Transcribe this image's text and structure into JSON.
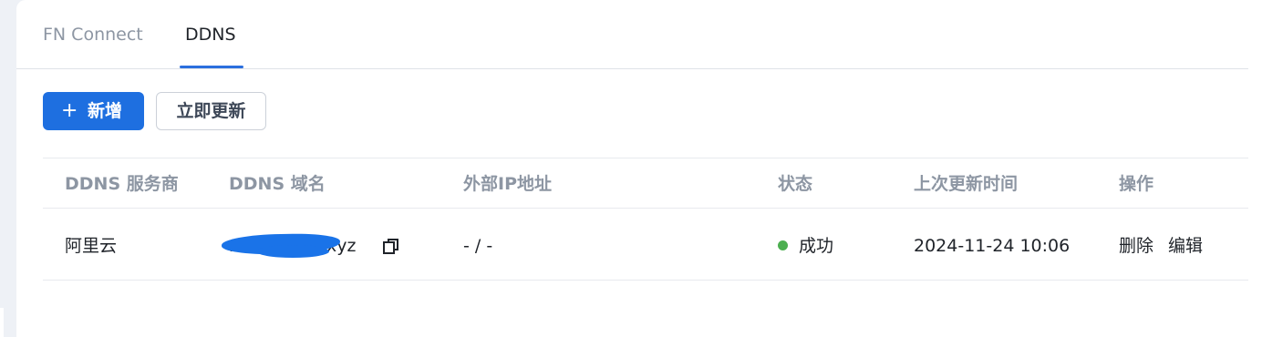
{
  "tabs": [
    {
      "label": "FN Connect",
      "active": false
    },
    {
      "label": "DDNS",
      "active": true
    }
  ],
  "toolbar": {
    "add_icon": "+",
    "add_label": "新增",
    "refresh_label": "立即更新"
  },
  "table": {
    "headers": [
      "DDNS 服务商",
      "DDNS 域名",
      "外部IP地址",
      "状态",
      "上次更新时间",
      "操作"
    ],
    "rows": [
      {
        "provider": "阿里云",
        "domain": "m.z·········0.xyz",
        "external_ip": "- / -",
        "status": "成功",
        "status_color": "#4caf50",
        "last_update": "2024-11-24 10:06",
        "actions": {
          "delete": "删除",
          "edit": "编辑"
        }
      }
    ]
  },
  "colors": {
    "accent": "#1e6fe0",
    "success": "#4caf50"
  },
  "icons": {
    "copy": "copy-icon",
    "add": "plus-icon",
    "status": "status-dot-icon"
  }
}
